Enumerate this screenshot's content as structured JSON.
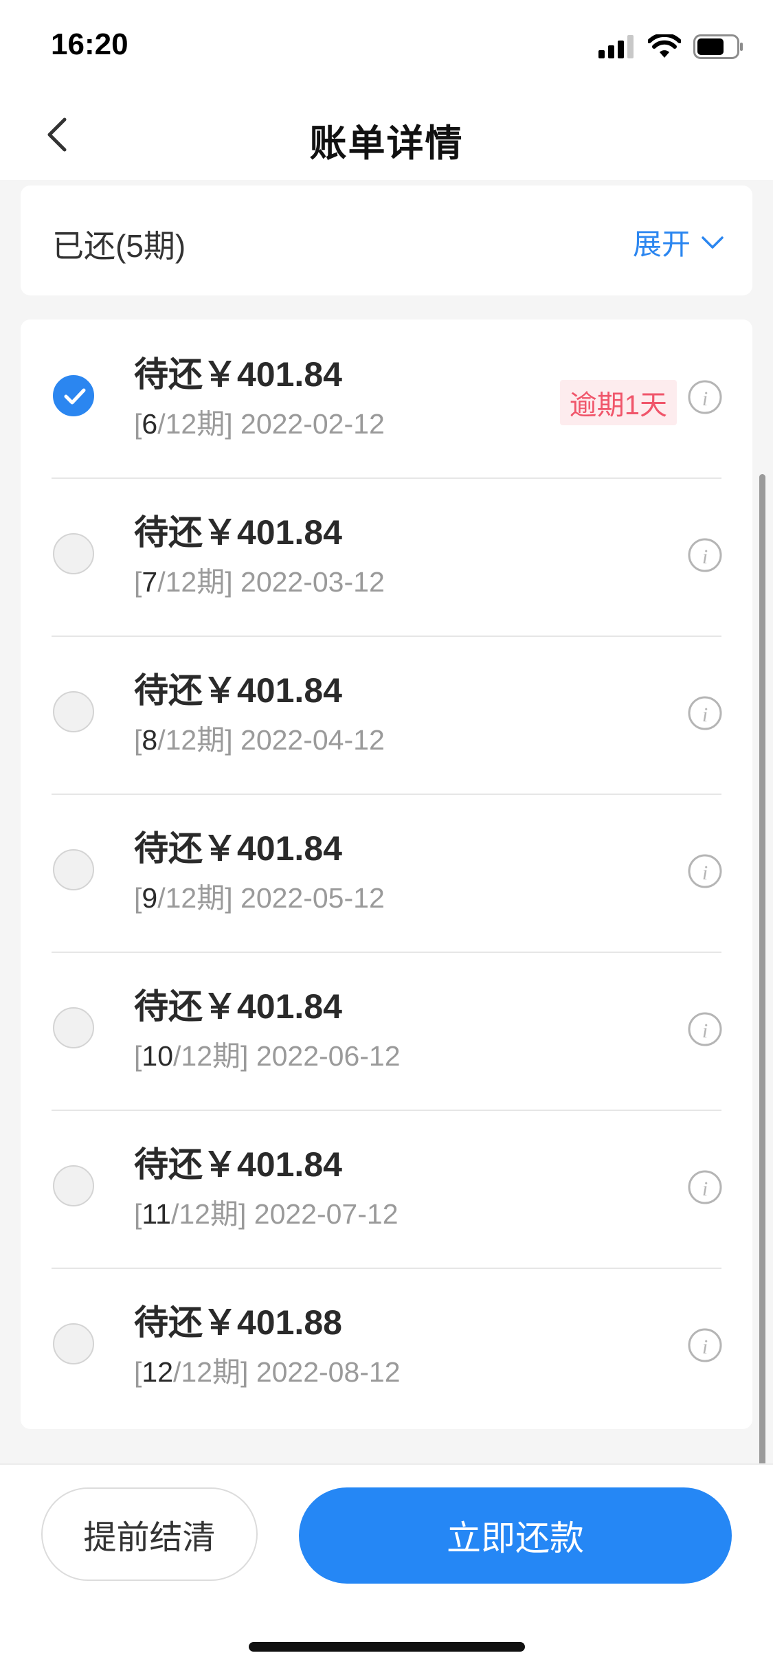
{
  "status_bar": {
    "time": "16:20"
  },
  "header": {
    "title": "账单详情",
    "back_icon": "chevron-left-icon"
  },
  "paid_section": {
    "label": "已还(5期)",
    "expand_label": "展开",
    "expand_icon": "chevron-down-icon"
  },
  "installments": [
    {
      "amount": "待还￥401.84",
      "current": "6",
      "total": "/12期]",
      "date": "2022-02-12",
      "checked": true,
      "badge": "逾期1天"
    },
    {
      "amount": "待还￥401.84",
      "current": "7",
      "total": "/12期]",
      "date": "2022-03-12",
      "checked": false
    },
    {
      "amount": "待还￥401.84",
      "current": "8",
      "total": "/12期]",
      "date": "2022-04-12",
      "checked": false
    },
    {
      "amount": "待还￥401.84",
      "current": "9",
      "total": "/12期]",
      "date": "2022-05-12",
      "checked": false
    },
    {
      "amount": "待还￥401.84",
      "current": "10",
      "total": "/12期]",
      "date": "2022-06-12",
      "checked": false
    },
    {
      "amount": "待还￥401.84",
      "current": "11",
      "total": "/12期]",
      "date": "2022-07-12",
      "checked": false
    },
    {
      "amount": "待还￥401.88",
      "current": "12",
      "total": "/12期]",
      "date": "2022-08-12",
      "checked": false
    }
  ],
  "bottom_bar": {
    "early_settle_label": "提前结清",
    "repay_now_label": "立即还款"
  },
  "colors": {
    "accent": "#2b86f0",
    "overdue": "#f0556a",
    "overdue_bg": "#fdecee"
  }
}
